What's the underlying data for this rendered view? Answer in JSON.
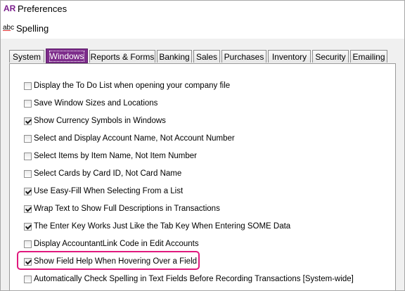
{
  "window": {
    "app_badge": "AR",
    "title": "Preferences"
  },
  "toolbar": {
    "spelling_icon": "abc-spellcheck-icon",
    "spelling_label": "Spelling"
  },
  "tabs": [
    {
      "label": "System",
      "active": false
    },
    {
      "label": "Windows",
      "active": true
    },
    {
      "label": "Reports & Forms",
      "active": false
    },
    {
      "label": "Banking",
      "active": false
    },
    {
      "label": "Sales",
      "active": false
    },
    {
      "label": "Purchases",
      "active": false
    },
    {
      "label": "Inventory",
      "active": false
    },
    {
      "label": "Security",
      "active": false
    },
    {
      "label": "Emailing",
      "active": false
    }
  ],
  "options": [
    {
      "label": "Display the To Do List when opening your company file",
      "checked": false
    },
    {
      "label": "Save Window Sizes and Locations",
      "checked": false
    },
    {
      "label": "Show Currency Symbols in Windows",
      "checked": true
    },
    {
      "label": "Select and Display Account Name, Not Account Number",
      "checked": false
    },
    {
      "label": "Select Items by Item Name, Not Item Number",
      "checked": false
    },
    {
      "label": "Select Cards by Card ID, Not Card Name",
      "checked": false
    },
    {
      "label": "Use Easy-Fill When Selecting From a List",
      "checked": true
    },
    {
      "label": "Wrap Text to Show Full Descriptions in Transactions",
      "checked": true
    },
    {
      "label": "The Enter Key Works Just Like the Tab Key When Entering SOME Data",
      "checked": true
    },
    {
      "label": "Display AccountantLink Code in Edit Accounts",
      "checked": false
    },
    {
      "label": "Show Field Help When Hovering Over a Field",
      "checked": true,
      "highlighted": true
    },
    {
      "label": "Automatically Check Spelling in Text Fields Before Recording Transactions [System-wide]",
      "checked": false
    }
  ],
  "colors": {
    "accent": "#7d2c8b",
    "highlight": "#e0197d"
  }
}
